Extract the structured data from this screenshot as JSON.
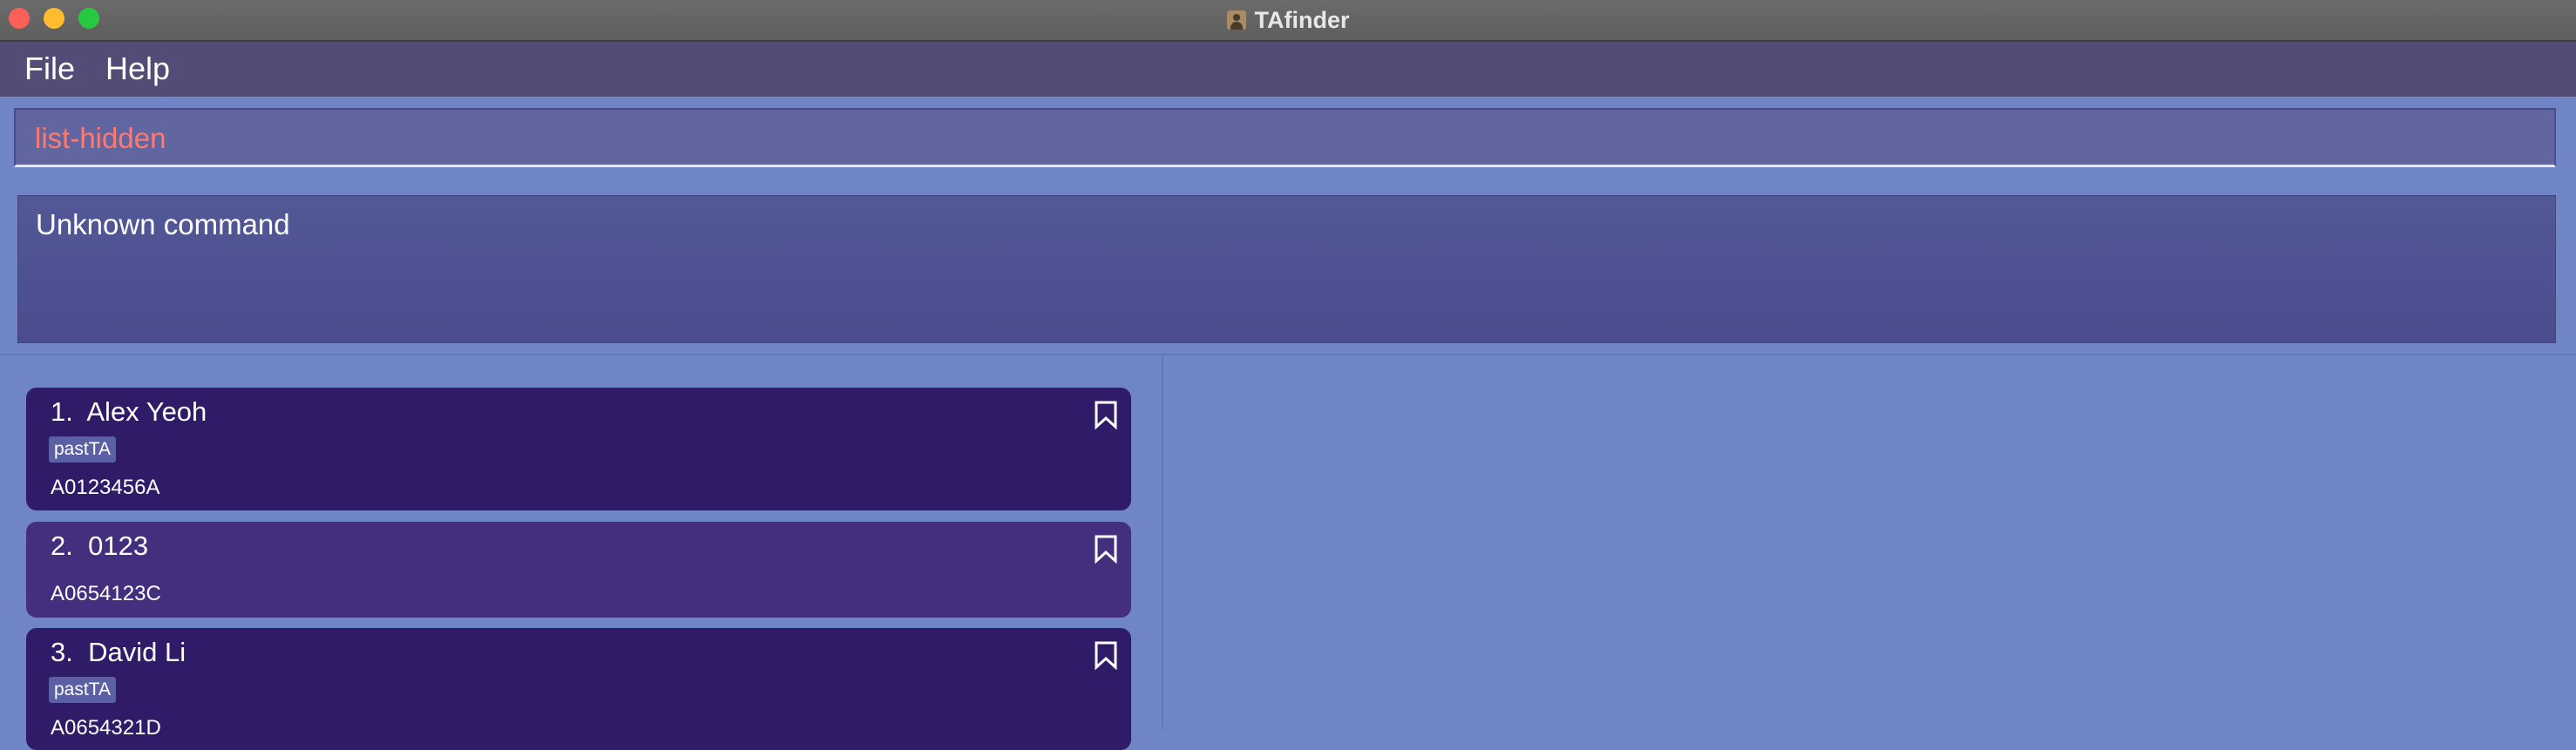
{
  "window": {
    "title": "TAfinder",
    "controls": [
      "close",
      "minimize",
      "maximize"
    ]
  },
  "menu": {
    "items": [
      "File",
      "Help"
    ]
  },
  "command": {
    "value": "list-hidden",
    "text_color": "#ff7a6e"
  },
  "result": {
    "message": "Unknown command"
  },
  "people": [
    {
      "index": "1.",
      "name": "Alex Yeoh",
      "tag": "pastTA",
      "id": "A0123456A",
      "icon": "bookmark-icon"
    },
    {
      "index": "2.",
      "name": "0123",
      "tag": "",
      "id": "A0654123C",
      "icon": "bookmark-icon"
    },
    {
      "index": "3.",
      "name": "David Li",
      "tag": "pastTA",
      "id": "A0654321D",
      "icon": "bookmark-icon"
    }
  ],
  "colors": {
    "background": "#7085c6",
    "menubar": "#524d77",
    "card_dark": "#2f1b68",
    "card_light": "#442f7f",
    "tag": "#5b5fa3"
  }
}
